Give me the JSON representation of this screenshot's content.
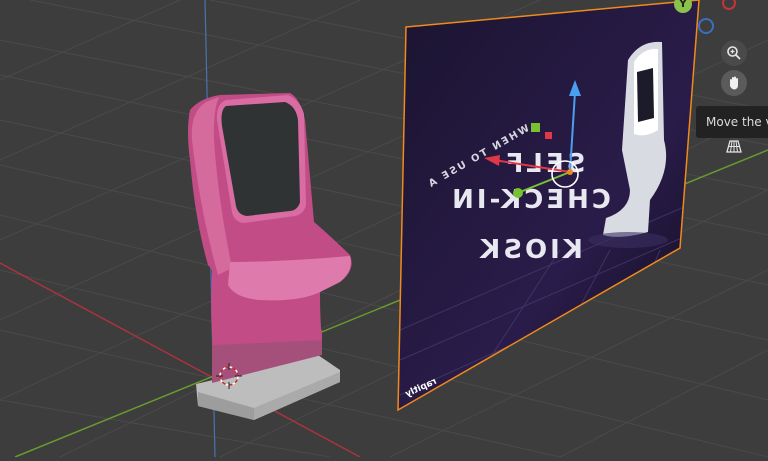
{
  "viewport": {
    "gizmo": {
      "y_axis_label": "Y"
    },
    "tooltip": "Move the view",
    "image_plane": {
      "heading_small": "WHEN TO USE A",
      "heading_line1": "SELF",
      "heading_line2": "CHECK-IN",
      "heading_line3": "KIOSK",
      "brand": "rapitly"
    }
  },
  "colors": {
    "background": "#3d3d3d",
    "grid_line": "#4a4a4a",
    "x_axis": "#a8343e",
    "y_axis": "#6a9a2e",
    "z_axis": "#4a72b0",
    "kiosk_body": "#c24d86",
    "selection_outline": "#f08a1c"
  },
  "icons": [
    "zoom-icon",
    "hand-icon",
    "grid-icon"
  ]
}
